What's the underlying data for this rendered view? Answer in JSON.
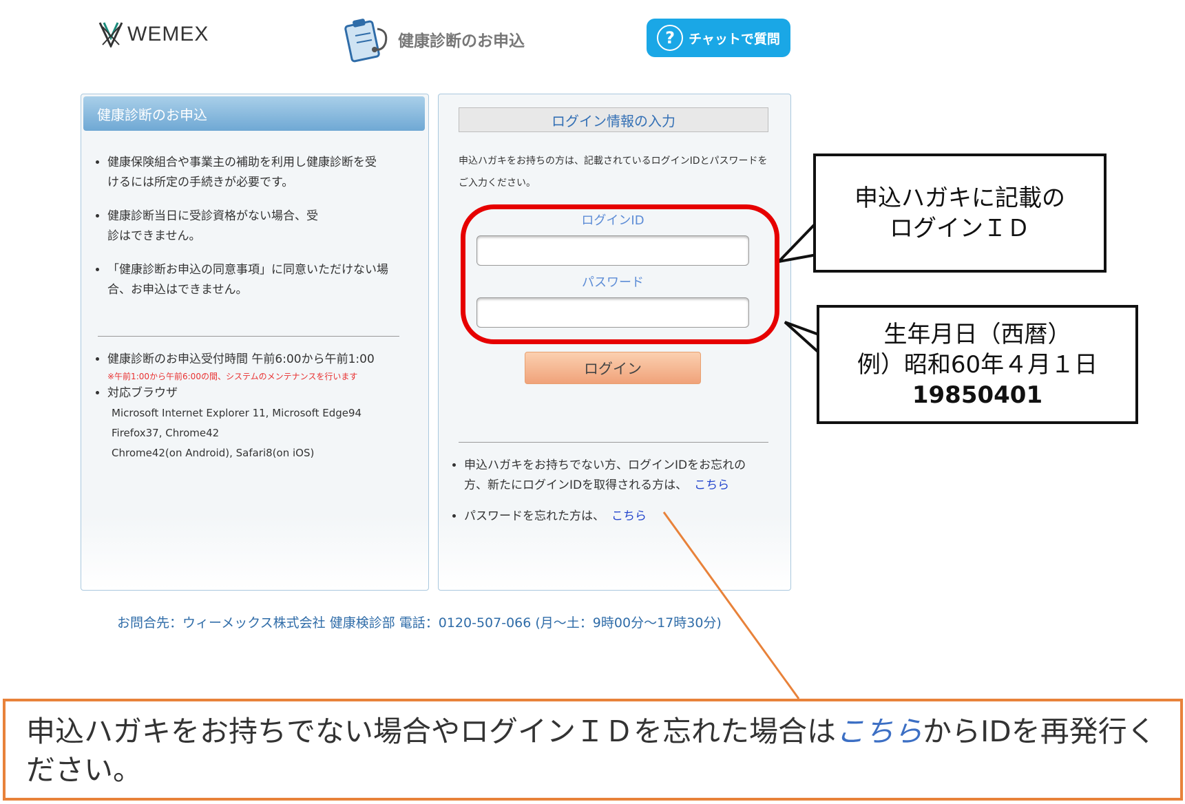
{
  "header": {
    "logo_text": "WEMEX",
    "app_label": "健康診断のお申込",
    "chat_button": "チャットで質問",
    "chat_icon": "?"
  },
  "left_panel": {
    "title": "健康診断のお申込",
    "bullets": [
      "健康保険組合や事業主の補助を利用し健康診断を受けるには所定の手続きが必要です。",
      "健康診断当日に受診資格がない場合、受診はできません。",
      "「健康診断お申込の同意事項」に同意いただけない場合、お申込はできません。"
    ],
    "hours_text": "健康診断のお申込受付時間 午前6:00から午前1:00",
    "hours_note": "※午前1:00から午前6:00の間、システムのメンテナンスを行います",
    "browsers_title": "対応ブラウザ",
    "browsers": [
      "Microsoft Internet Explorer 11, Microsoft Edge94",
      "Firefox37, Chrome42",
      "Chrome42(on Android), Safari8(on iOS)"
    ]
  },
  "login": {
    "title": "ログイン情報の入力",
    "description": "申込ハガキをお持ちの方は、記載されているログインIDとパスワードをご入力ください。",
    "id_label": "ログインID",
    "id_value": "",
    "password_label": "パスワード",
    "password_value": "",
    "login_button": "ログイン",
    "help1_text": "申込ハガキをお持ちでない方、ログインIDをお忘れの方、新たにログインIDを取得される方は、",
    "help1_link": "こちら",
    "help2_text": "パスワードを忘れた方は、",
    "help2_link": "こちら"
  },
  "footer": {
    "contact": "お問合先：ウィーメックス株式会社 健康検診部 電話：0120-507-066 (月～土：9時00分～17時30分)"
  },
  "annotations": {
    "callout_id_line1": "申込ハガキに記載の",
    "callout_id_line2": "ログインＩＤ",
    "callout_pw_line1": "生年月日（西暦）",
    "callout_pw_line2": "例）昭和60年４月１日",
    "callout_pw_line3": "19850401",
    "bottom_note_before": "申込ハガキをお持ちでない場合やログインＩＤを忘れた場合は",
    "bottom_note_link": "こちら",
    "bottom_note_after": "からIDを再発行ください。",
    "colors": {
      "red_highlight": "#e60000",
      "orange_note": "#e8823a",
      "callout_border": "#111111"
    }
  }
}
